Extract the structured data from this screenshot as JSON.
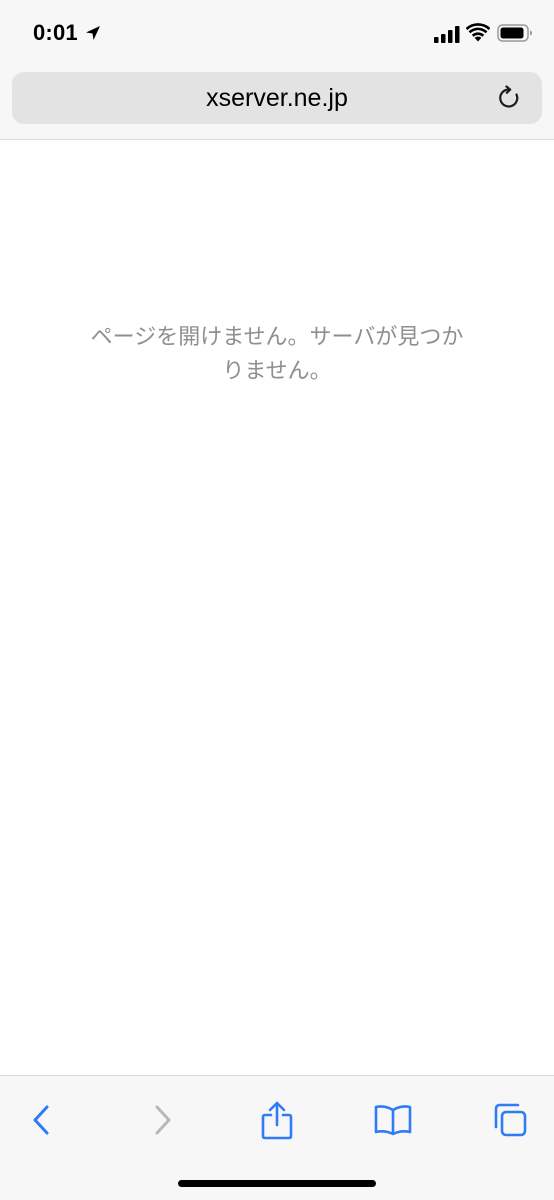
{
  "status_bar": {
    "time": "0:01"
  },
  "address_bar": {
    "url": "xserver.ne.jp"
  },
  "content": {
    "error_line1": "ページを開けません。サーバが見つか",
    "error_line2": "りません。"
  },
  "toolbar": {
    "items": [
      "back",
      "forward",
      "share",
      "bookmarks",
      "tabs"
    ]
  },
  "colors": {
    "accent": "#2f7cf6",
    "disabled": "#b8b8bc",
    "message": "#8e8e93"
  }
}
